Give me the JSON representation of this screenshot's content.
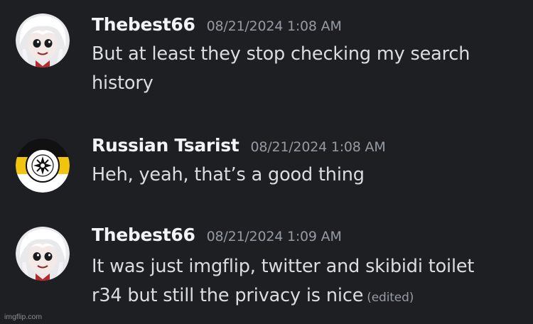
{
  "messages": [
    {
      "username": "Thebest66",
      "timestamp": "08/21/2024 1:08 AM",
      "lines": [
        "But at least they stop checking my search",
        "history"
      ],
      "avatar_icon": "anime-girl-avatar-icon"
    },
    {
      "username": "Russian Tsarist",
      "timestamp": "08/21/2024 1:08 AM",
      "lines": [
        "Heh, yeah, that’s a good thing"
      ],
      "avatar_icon": "imperial-flag-emblem-avatar-icon"
    },
    {
      "username": "Thebest66",
      "timestamp": "08/21/2024 1:09 AM",
      "lines": [
        "It was just imgflip, twitter and skibidi toilet",
        "r34 but still the privacy is nice"
      ],
      "edited_label": "(edited)",
      "avatar_icon": "anime-girl-avatar-icon"
    }
  ],
  "watermark": "imgflip.com",
  "colors": {
    "background": "#1e1f22",
    "username": "#f2f3f5",
    "text": "#dbdee1",
    "muted": "#949ba4",
    "flag_black": "#111111",
    "flag_yellow": "#f1c40f",
    "flag_white": "#ffffff"
  }
}
